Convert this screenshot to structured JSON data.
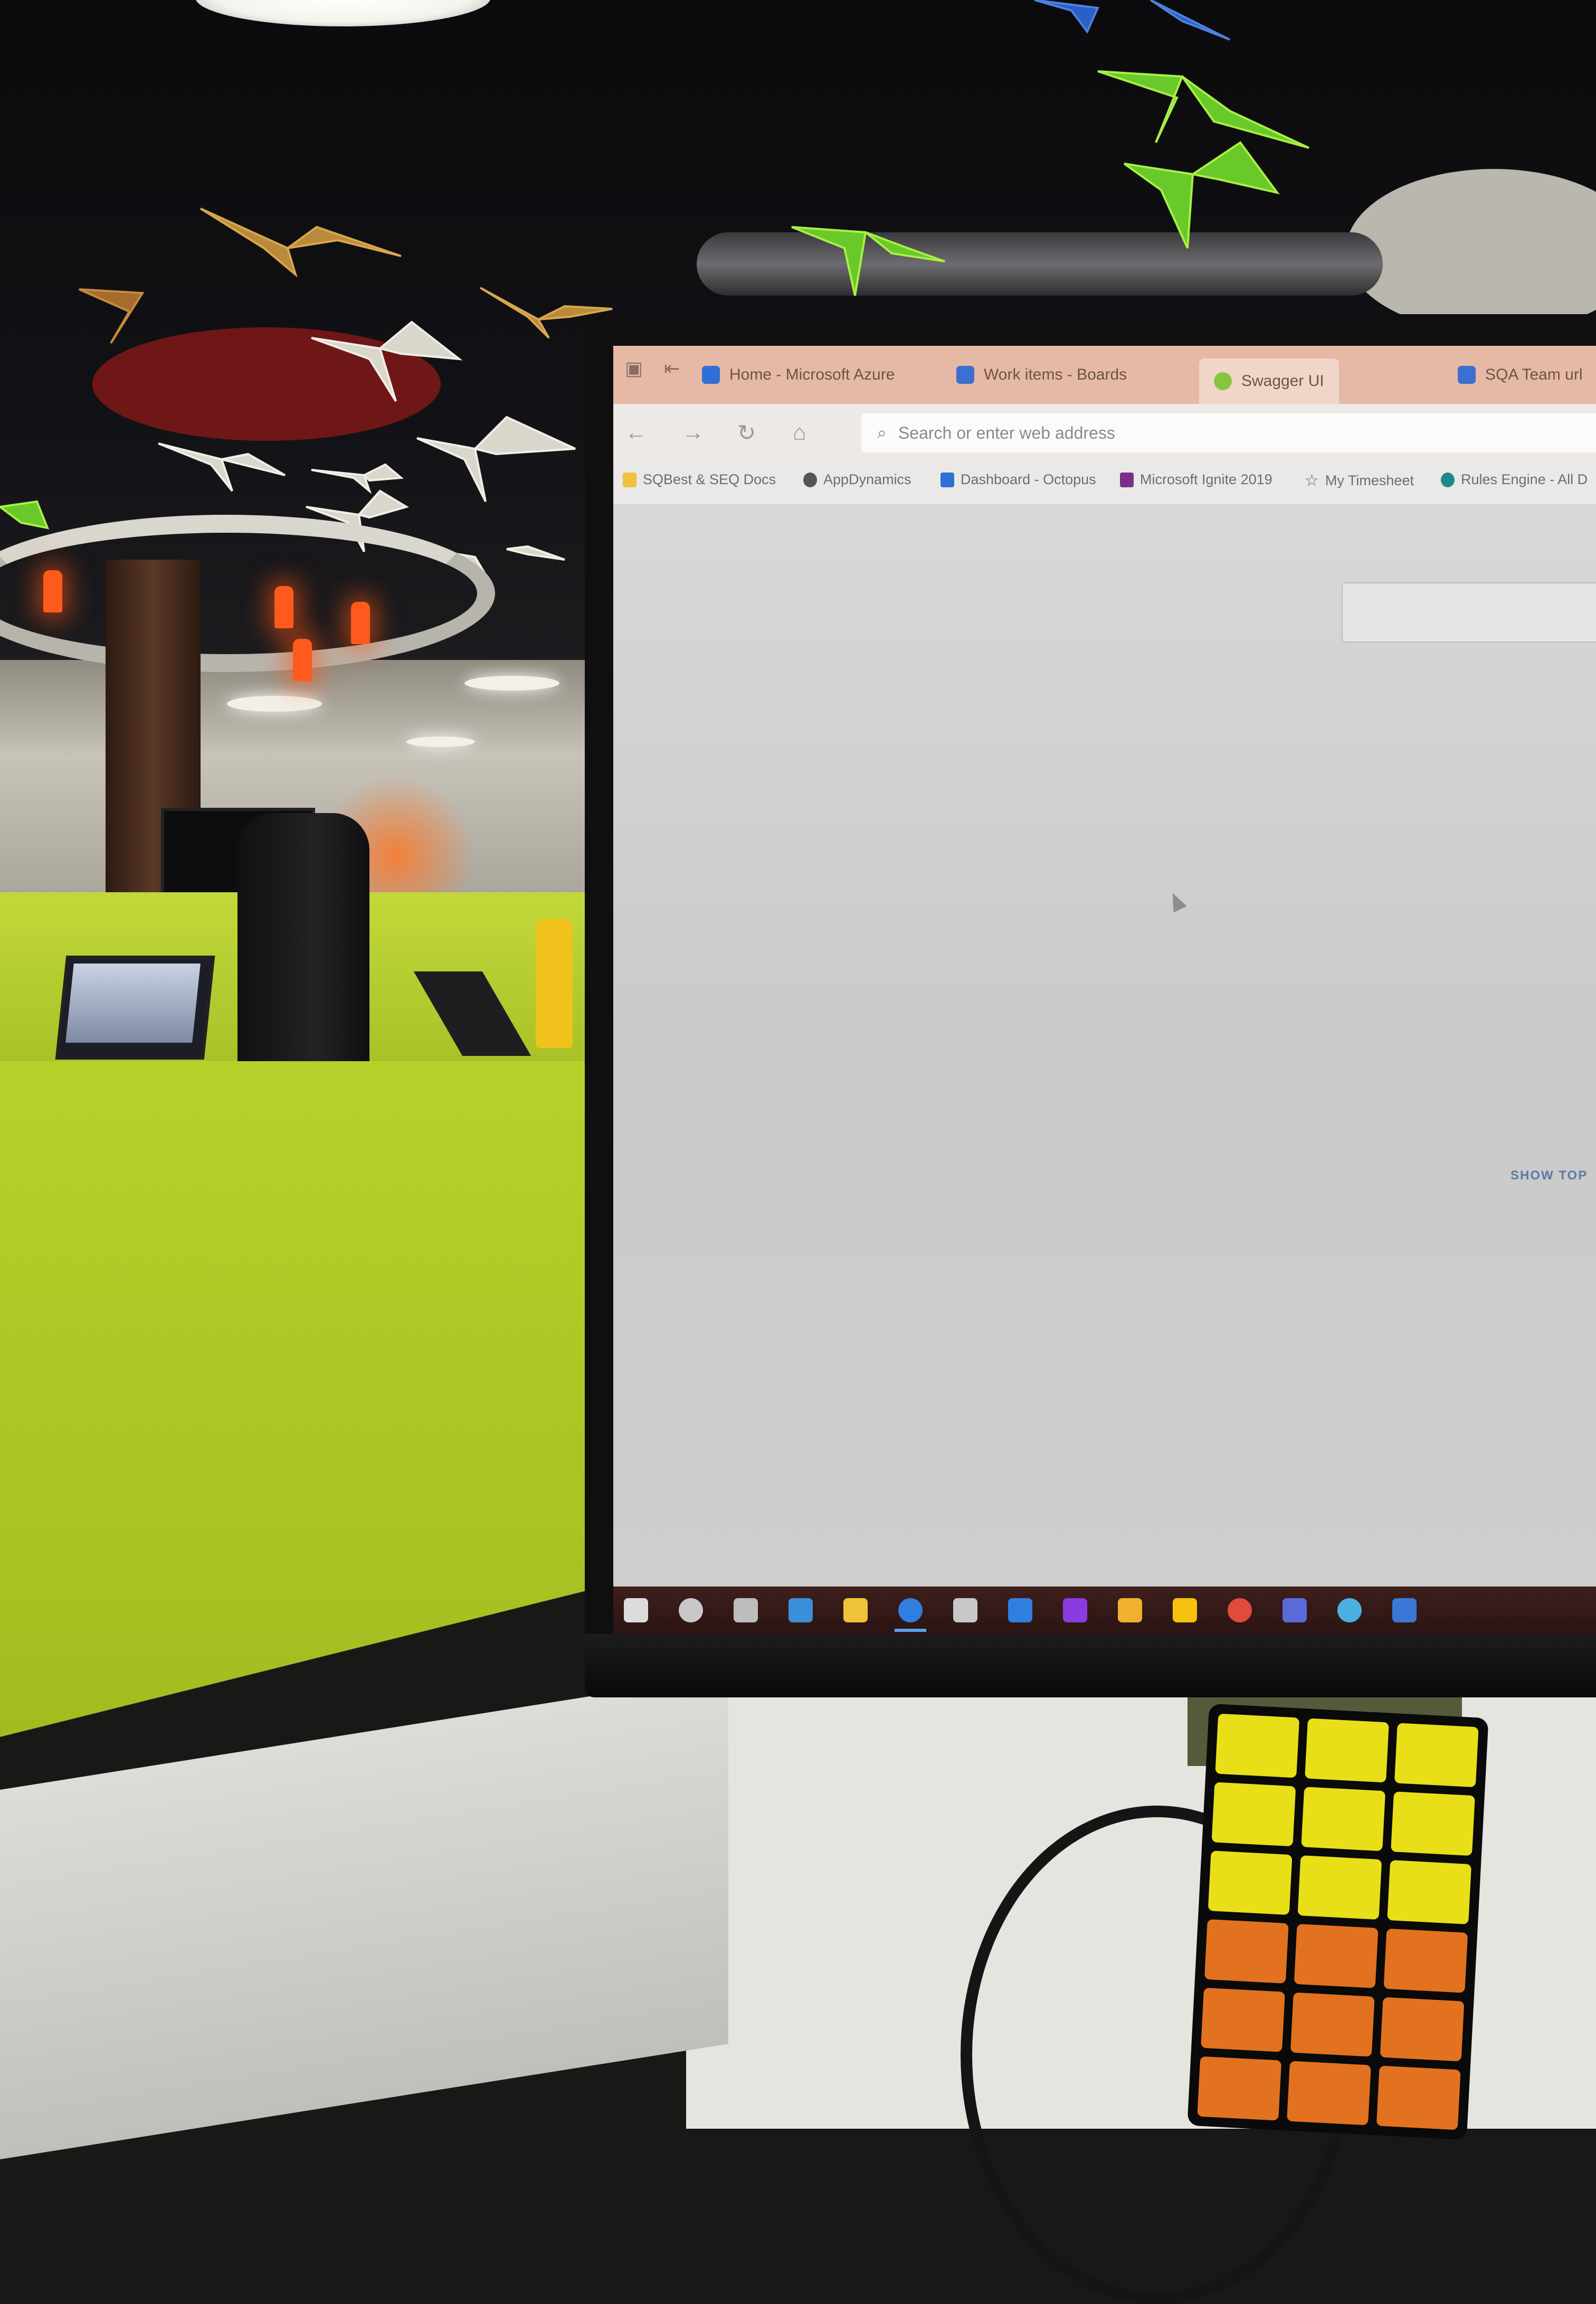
{
  "browser": {
    "tabs": [
      {
        "title": "Home - Microsoft Azure",
        "icon": "azure-icon",
        "color": "#2f6fd6"
      },
      {
        "title": "Work items - Boards",
        "icon": "azure-devops-icon",
        "color": "#3b6fd1"
      },
      {
        "title": "Swagger UI",
        "icon": "swagger-icon",
        "color": "#85c540"
      },
      {
        "title": "SQA Team url",
        "icon": "azure-devops-icon",
        "color": "#3b6fd1"
      }
    ],
    "address_placeholder": "Search or enter web address",
    "favorites": [
      {
        "label": "SQBest & SEQ Docs",
        "icon": "folder-icon",
        "color": "#f0c23b"
      },
      {
        "label": "AppDynamics",
        "icon": "appdynamics-icon",
        "color": "#555555"
      },
      {
        "label": "Dashboard - Octopus",
        "icon": "octopus-icon",
        "color": "#2f6fd6"
      },
      {
        "label": "Microsoft Ignite 2019",
        "icon": "onenote-icon",
        "color": "#7b2e8e"
      },
      {
        "label": "My Timesheet",
        "icon": "star-icon",
        "color": "#666666"
      },
      {
        "label": "Rules Engine - All D",
        "icon": "edge-icon",
        "color": "#1f8a8a"
      }
    ],
    "page": {
      "show_top": "SHOW TOP"
    }
  },
  "taskbar": {
    "icons": [
      {
        "name": "windows-start-icon",
        "color": "#dcdcdc"
      },
      {
        "name": "search-icon",
        "color": "#c8c8c8"
      },
      {
        "name": "task-view-icon",
        "color": "#bdbdbd"
      },
      {
        "name": "azure-storage-explorer-icon",
        "color": "#3a8fd8"
      },
      {
        "name": "file-explorer-icon",
        "color": "#f0c23b"
      },
      {
        "name": "edge-icon",
        "color": "#2f7fe0"
      },
      {
        "name": "paint-icon",
        "color": "#c8c8c8"
      },
      {
        "name": "outlook-icon",
        "color": "#2f7fe0"
      },
      {
        "name": "visual-studio-icon",
        "color": "#8a3ce0"
      },
      {
        "name": "pen-tool-icon",
        "color": "#f0b030"
      },
      {
        "name": "sticky-notes-icon",
        "color": "#f4c20d"
      },
      {
        "name": "chrome-icon",
        "color": "#e24a3a"
      },
      {
        "name": "teams-icon",
        "color": "#5b6ad8"
      },
      {
        "name": "browser-icon",
        "color": "#4ab0e0"
      },
      {
        "name": "remote-desktop-icon",
        "color": "#3a78d8"
      }
    ]
  },
  "scene": {
    "partition_color": "#b6d12a",
    "cube_colors": [
      "#e8df19",
      "#e2721f"
    ]
  }
}
